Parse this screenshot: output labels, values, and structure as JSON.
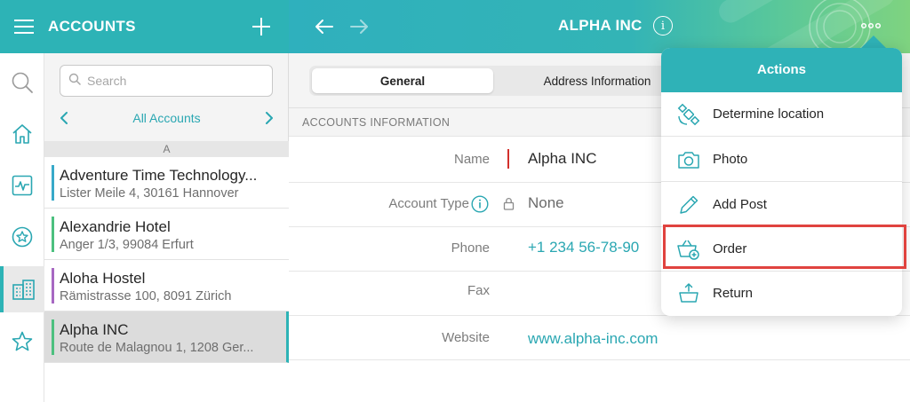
{
  "colors": {
    "accent": "#2db3b6",
    "highlight": "#e0433f",
    "required": "#d3302c"
  },
  "left_header": {
    "title": "ACCOUNTS",
    "menu_icon": "hamburger-icon",
    "add_icon": "plus-icon"
  },
  "right_header": {
    "title": "ALPHA INC",
    "back_icon": "arrow-left-icon",
    "forward_icon": "arrow-right-icon",
    "info_icon": "info-icon",
    "more_icon": "more-dots-icon"
  },
  "rail": [
    {
      "icon": "search-icon"
    },
    {
      "icon": "home-icon"
    },
    {
      "icon": "activity-icon"
    },
    {
      "icon": "star-circle-icon"
    },
    {
      "icon": "accounts-building-icon",
      "active": true
    },
    {
      "icon": "star-person-icon"
    }
  ],
  "list": {
    "search_placeholder": "Search",
    "filter_label": "All Accounts",
    "section_letter": "A",
    "items": [
      {
        "name": "Adventure Time Technology...",
        "address": "Lister Meile 4, 30161 Hannover",
        "color": "#38a9c9"
      },
      {
        "name": "Alexandrie Hotel",
        "address": "Anger 1/3, 99084 Erfurt",
        "color": "#4cc07f"
      },
      {
        "name": "Aloha Hostel",
        "address": "Rämistrasse 100, 8091 Zürich",
        "color": "#a768c2"
      },
      {
        "name": "Alpha INC",
        "address": "Route de Malagnou 1, 1208 Ger...",
        "color": "#4cc07f",
        "selected": true
      }
    ]
  },
  "detail": {
    "tabs": [
      {
        "label": "General",
        "active": true
      },
      {
        "label": "Address Information"
      }
    ],
    "section_title": "ACCOUNTS INFORMATION",
    "fields": [
      {
        "label": "Name",
        "value": "Alpha INC",
        "required": true
      },
      {
        "label": "Account Type",
        "value": "None",
        "has_info": true,
        "locked": true
      },
      {
        "label": "Phone",
        "value": "+1 234 56-78-90",
        "link": true
      },
      {
        "label": "Fax",
        "value": ""
      },
      {
        "label": "Website",
        "value": "www.alpha-inc.com",
        "link": true
      }
    ]
  },
  "actions_menu": {
    "title": "Actions",
    "items": [
      {
        "label": "Determine location",
        "icon": "satellite-icon"
      },
      {
        "label": "Photo",
        "icon": "camera-icon"
      },
      {
        "label": "Add Post",
        "icon": "pencil-icon"
      },
      {
        "label": "Order",
        "icon": "basket-add-icon",
        "highlighted": true
      },
      {
        "label": "Return",
        "icon": "basket-return-icon"
      }
    ]
  }
}
